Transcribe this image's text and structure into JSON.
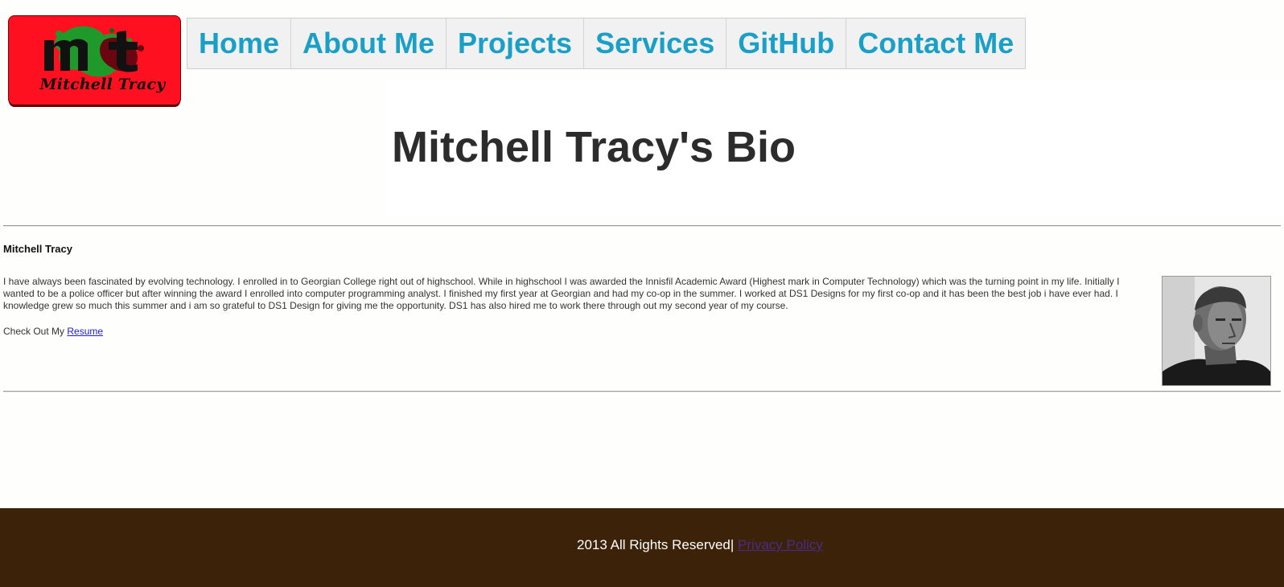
{
  "logo": {
    "text": "Mitchell Tracy"
  },
  "nav": {
    "items": [
      {
        "label": "Home"
      },
      {
        "label": "About Me"
      },
      {
        "label": "Projects"
      },
      {
        "label": "Services"
      },
      {
        "label": "GitHub"
      },
      {
        "label": "Contact Me"
      }
    ]
  },
  "page": {
    "title": "Mitchell Tracy's Bio"
  },
  "bio": {
    "name": "Mitchell Tracy",
    "text": "I have always been fascinated by evolving technology. I enrolled in to Georgian College right out of highschool. While in highschool I was awarded the Innisfil Academic Award (Highest mark in Computer Technology) which was the turning point in my life. Initially I wanted to be a police officer but after winning the award I enrolled into computer programming analyst. I finished my first year at Georgian and had my co-op in the summer. I worked at DS1 Designs for my first co-op and it has been the best job i have ever had. I knowledge grew so much this summer and i am so grateful to DS1 Design for giving me the opportunity. DS1 has also hired me to work there through out my second year of my course.",
    "resume_prefix": "Check Out My",
    "resume_link": "Resume"
  },
  "footer": {
    "text": "2013 All Rights Reserved|",
    "privacy_link": "Privacy Policy"
  },
  "colors": {
    "nav_link": "#1aa0c6",
    "logo_bg": "#ff1020",
    "footer_bg": "#3c2208"
  }
}
